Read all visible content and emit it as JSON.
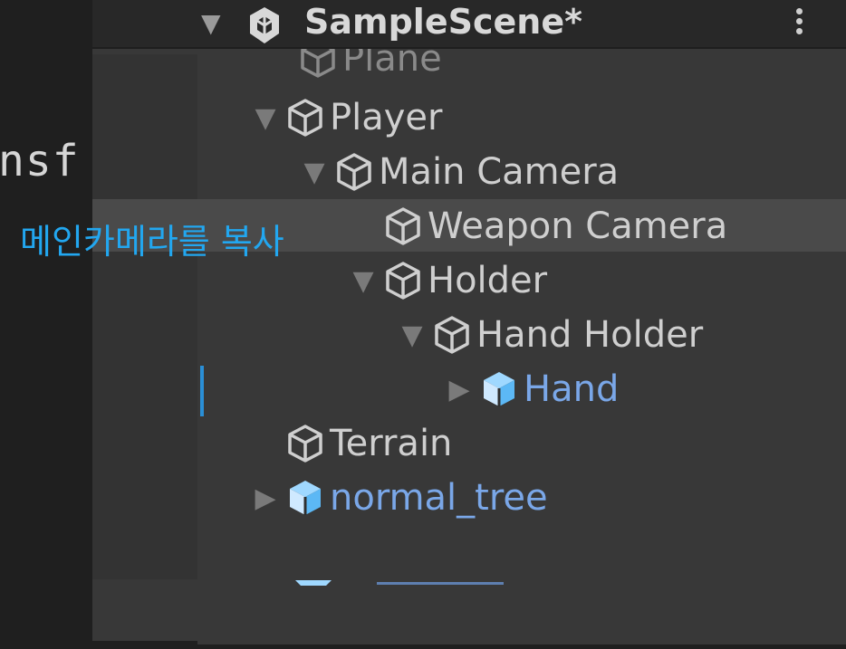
{
  "editor": {
    "code_fragment": "nsf"
  },
  "hierarchy": {
    "scene_title": "SampleScene*",
    "items": [
      {
        "label": "Plane",
        "type": "gameobject",
        "expand": "none"
      },
      {
        "label": "Player",
        "type": "gameobject",
        "expand": "expanded"
      },
      {
        "label": "Main Camera",
        "type": "gameobject",
        "expand": "expanded"
      },
      {
        "label": "Weapon Camera",
        "type": "gameobject",
        "expand": "none"
      },
      {
        "label": "Holder",
        "type": "gameobject",
        "expand": "expanded"
      },
      {
        "label": "Hand Holder",
        "type": "gameobject",
        "expand": "expanded"
      },
      {
        "label": "Hand",
        "type": "prefab",
        "expand": "collapsed"
      },
      {
        "label": "Terrain",
        "type": "gameobject",
        "expand": "none"
      },
      {
        "label": "normal_tree",
        "type": "prefab",
        "expand": "collapsed"
      }
    ]
  },
  "annotation": {
    "text": "메인카메라를 복사"
  },
  "colors": {
    "panel_bg": "#383838",
    "header_bg": "#282828",
    "selected_row_bg": "#4a4a4a",
    "prefab_text": "#7aa7e8",
    "annotation_text": "#22a7f0",
    "cursor": "#2a8fd6"
  },
  "icons": {
    "scene": "unity-scene-icon",
    "gameobject": "cube-outline-icon",
    "prefab": "prefab-cube-icon",
    "menu": "kebab-menu-icon"
  }
}
